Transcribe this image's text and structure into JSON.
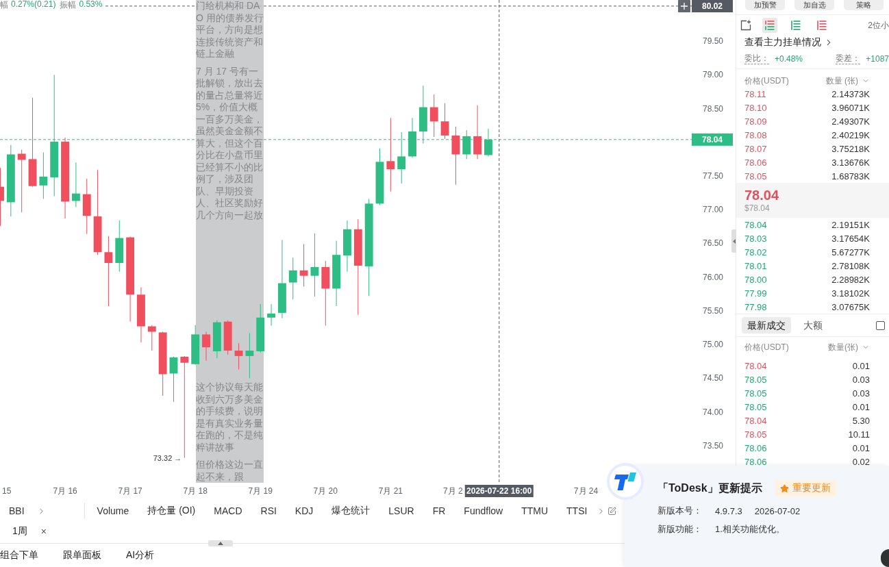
{
  "chart_info": [
    {
      "label": "幅",
      "value": "0.27%(0.21)"
    },
    {
      "label": "振幅",
      "value": "0.53%"
    }
  ],
  "chart": {
    "chart_data": [
      {
        "type": "candlestick",
        "x": [
          "2026-07-15T00:00",
          "2026-07-15T04:00",
          "2026-07-15T08:00",
          "2026-07-15T12:00",
          "2026-07-15T16:00",
          "2026-07-15T20:00",
          "2026-07-16T00:00",
          "2026-07-16T04:00",
          "2026-07-16T08:00",
          "2026-07-16T12:00",
          "2026-07-16T16:00",
          "2026-07-16T20:00",
          "2026-07-17T00:00",
          "2026-07-17T04:00",
          "2026-07-17T08:00",
          "2026-07-17T12:00",
          "2026-07-17T16:00",
          "2026-07-17T20:00",
          "2026-07-18T00:00",
          "2026-07-18T04:00",
          "2026-07-18T08:00",
          "2026-07-18T12:00",
          "2026-07-18T16:00",
          "2026-07-18T20:00",
          "2026-07-19T00:00",
          "2026-07-19T04:00",
          "2026-07-19T08:00",
          "2026-07-19T12:00",
          "2026-07-19T16:00",
          "2026-07-19T20:00",
          "2026-07-20T00:00",
          "2026-07-20T04:00",
          "2026-07-20T08:00",
          "2026-07-20T12:00",
          "2026-07-20T16:00",
          "2026-07-20T20:00",
          "2026-07-21T00:00",
          "2026-07-21T04:00",
          "2026-07-21T08:00",
          "2026-07-21T12:00",
          "2026-07-21T16:00",
          "2026-07-21T20:00",
          "2026-07-22T00:00",
          "2026-07-22T04:00",
          "2026-07-22T08:00",
          "2026-07-22T12:00"
        ],
        "ohlc": [
          [
            77.34,
            77.62,
            76.76,
            77.13
          ],
          [
            77.11,
            77.96,
            76.9,
            77.82
          ],
          [
            77.83,
            77.89,
            76.96,
            77.74
          ],
          [
            77.75,
            78.66,
            77.34,
            77.35
          ],
          [
            77.36,
            77.85,
            77.16,
            77.49
          ],
          [
            77.48,
            79.0,
            77.2,
            78.01
          ],
          [
            78.01,
            78.07,
            76.87,
            77.12
          ],
          [
            77.13,
            77.7,
            77.04,
            77.24
          ],
          [
            77.23,
            77.46,
            76.64,
            76.91
          ],
          [
            76.9,
            77.59,
            76.33,
            76.37
          ],
          [
            76.37,
            76.61,
            75.57,
            76.21
          ],
          [
            76.21,
            76.84,
            76.08,
            76.58
          ],
          [
            76.59,
            76.6,
            75.34,
            75.74
          ],
          [
            75.74,
            75.85,
            75.03,
            75.27
          ],
          [
            75.27,
            75.29,
            74.91,
            75.19
          ],
          [
            75.18,
            75.19,
            74.24,
            74.56
          ],
          [
            74.57,
            74.82,
            74.15,
            74.81
          ],
          [
            74.82,
            74.83,
            73.32,
            74.73
          ],
          [
            74.71,
            75.29,
            74.7,
            75.15
          ],
          [
            75.15,
            75.19,
            74.76,
            74.96
          ],
          [
            74.9,
            75.36,
            74.8,
            75.33
          ],
          [
            75.34,
            75.36,
            74.85,
            74.91
          ],
          [
            74.91,
            75.02,
            74.63,
            74.83
          ],
          [
            74.83,
            75.17,
            74.5,
            74.91
          ],
          [
            74.9,
            75.6,
            74.88,
            75.4
          ],
          [
            75.4,
            75.6,
            75.28,
            75.46
          ],
          [
            75.47,
            76.55,
            75.39,
            75.91
          ],
          [
            75.92,
            76.29,
            75.67,
            76.1
          ],
          [
            76.1,
            76.49,
            75.86,
            76.02
          ],
          [
            76.02,
            76.65,
            75.71,
            76.15
          ],
          [
            76.15,
            76.24,
            75.28,
            75.83
          ],
          [
            75.83,
            76.54,
            75.57,
            76.33
          ],
          [
            76.32,
            76.84,
            76.08,
            76.71
          ],
          [
            76.71,
            76.86,
            75.44,
            76.17
          ],
          [
            76.16,
            77.16,
            75.72,
            77.09
          ],
          [
            77.09,
            77.91,
            77.07,
            77.71
          ],
          [
            77.72,
            78.36,
            77.27,
            77.6
          ],
          [
            77.6,
            78.15,
            77.39,
            77.79
          ],
          [
            77.79,
            78.36,
            77.77,
            78.16
          ],
          [
            78.16,
            78.84,
            77.98,
            78.52
          ],
          [
            78.52,
            78.71,
            78.08,
            78.31
          ],
          [
            78.31,
            78.58,
            78.05,
            78.1
          ],
          [
            78.1,
            78.23,
            77.37,
            77.82
          ],
          [
            77.82,
            78.18,
            77.75,
            78.09
          ],
          [
            78.09,
            78.55,
            77.75,
            77.82
          ],
          [
            77.81,
            78.2,
            77.79,
            78.04
          ]
        ],
        "colors": [
          "#f0505e",
          "#2ebd85",
          "#f0505e",
          "#f0505e",
          "#2ebd85",
          "#2ebd85",
          "#f0505e",
          "#2ebd85",
          "#f0505e",
          "#f0505e",
          "#f0505e",
          "#2ebd85",
          "#f0505e",
          "#f0505e",
          "#f0505e",
          "#f0505e",
          "#2ebd85",
          "#f0505e",
          "#2ebd85",
          "#f0505e",
          "#2ebd85",
          "#f0505e",
          "#f0505e",
          "#2ebd85",
          "#2ebd85",
          "#2ebd85",
          "#2ebd85",
          "#2ebd85",
          "#f0505e",
          "#2ebd85",
          "#f0505e",
          "#2ebd85",
          "#2ebd85",
          "#f0505e",
          "#2ebd85",
          "#2ebd85",
          "#f0505e",
          "#2ebd85",
          "#2ebd85",
          "#2ebd85",
          "#f0505e",
          "#f0505e",
          "#f0505e",
          "#2ebd85",
          "#f0505e",
          "#2ebd85"
        ],
        "xlim": [
          "2026-07-15T00:00",
          "2026-07-25T15:00"
        ],
        "ylim": [
          72.95,
          80.11
        ],
        "xticks": [
          {
            "value": "2026-07-15T00:00",
            "label": "15"
          },
          {
            "value": "2026-07-16T00:00",
            "label": "7月 16"
          },
          {
            "value": "2026-07-17T00:00",
            "label": "7月 17"
          },
          {
            "value": "2026-07-18T00:00",
            "label": "7月 18"
          },
          {
            "value": "2026-07-19T00:00",
            "label": "7月 19"
          },
          {
            "value": "2026-07-20T00:00",
            "label": "7月 20"
          },
          {
            "value": "2026-07-21T00:00",
            "label": "7月 21"
          },
          {
            "value": "2026-07-22T00:00",
            "label": "7月 2"
          },
          {
            "value": "2026-07-24T00:00",
            "label": "7月 24"
          }
        ],
        "yticks": [
          {
            "value": 79.5,
            "label": "79.50"
          },
          {
            "value": 79.0,
            "label": "79.00"
          },
          {
            "value": 78.5,
            "label": "78.50"
          },
          {
            "value": 77.5,
            "label": "77.50"
          },
          {
            "value": 77.0,
            "label": "77.00"
          },
          {
            "value": 76.5,
            "label": "76.50"
          },
          {
            "value": 76.0,
            "label": "76.00"
          },
          {
            "value": 75.5,
            "label": "75.50"
          },
          {
            "value": 75.0,
            "label": "75.00"
          },
          {
            "value": 74.5,
            "label": "74.50"
          },
          {
            "value": 74.0,
            "label": "74.00"
          },
          {
            "value": 73.5,
            "label": "73.50"
          }
        ],
        "ref_lines": [
          {
            "axis": "y",
            "value": 78.04,
            "label": "78.04",
            "color": "#2ebd85",
            "line_style": "dashed"
          },
          {
            "axis": "y",
            "value": 80.02,
            "label": "80.02",
            "color": "#555a62",
            "line_style": "dashed"
          },
          {
            "axis": "x",
            "value": "2026-07-22T16:00",
            "label": "2026-07-22 16:00",
            "color": "#555a62",
            "line_style": "dashed"
          }
        ],
        "annotations": [
          "73.32 →"
        ]
      }
    ]
  },
  "note_overlay": {
    "paragraphs": [
      "门给机构和 DAO 用的债券发行平台，方向是想连接传统资产和链上金融",
      "7 月 17 号有一批解锁，放出去的量占总量将近 5%，价值大概一百多万美金，虽然美金金额不算大，但这个百分比在小盘币里已经算不小的比例了，涉及团队、早期投资人、社区奖励好几个方向一起放",
      "这个协议每天能收到六万多美金的手续费，说明是有真实业务量在跑的，不是纯粹讲故事",
      "但价格这边一直起不来，跟"
    ]
  },
  "indicator_bar": {
    "main": [
      "BBI"
    ],
    "sub": [
      "Volume",
      "持仓量 (OI)",
      "MACD",
      "RSI",
      "KDJ",
      "爆仓统计",
      "LSUR",
      "FR",
      "Fundflow",
      "TTMU",
      "TTSI"
    ]
  },
  "period_tags": [
    {
      "label": "1周",
      "close": "×"
    }
  ],
  "bottom_tabs": [
    "组合下单",
    "跟单面板",
    "AI分析"
  ],
  "order_panel": {
    "top_buttons": [
      "加预警",
      "加自选",
      "策略"
    ],
    "view_modes": [
      {
        "kind": "both",
        "selected": true
      },
      {
        "kind": "bids",
        "selected": false
      },
      {
        "kind": "asks",
        "selected": false
      }
    ],
    "decimals": "2位小",
    "link": "查看主力挂单情况",
    "ratio": {
      "label": "委比：",
      "value": "+0.48%"
    },
    "diff": {
      "label": "委差：",
      "value": "+1087"
    },
    "columns": [
      "价格(USDT)",
      "数量 (张)"
    ],
    "asks": [
      {
        "price": "78.11",
        "amount": "2.14373K"
      },
      {
        "price": "78.10",
        "amount": "3.96071K"
      },
      {
        "price": "78.09",
        "amount": "2.49307K"
      },
      {
        "price": "78.08",
        "amount": "2.40219K"
      },
      {
        "price": "78.07",
        "amount": "3.75218K"
      },
      {
        "price": "78.06",
        "amount": "3.13676K"
      },
      {
        "price": "78.05",
        "amount": "1.68783K"
      }
    ],
    "last_price": "78.04",
    "last_price_usd": "$78.04",
    "bids": [
      {
        "price": "78.04",
        "amount": "2.19151K"
      },
      {
        "price": "78.03",
        "amount": "3.17654K"
      },
      {
        "price": "78.02",
        "amount": "5.67277K"
      },
      {
        "price": "78.01",
        "amount": "2.78108K"
      },
      {
        "price": "78.00",
        "amount": "2.28982K"
      },
      {
        "price": "77.99",
        "amount": "3.18102K"
      },
      {
        "price": "77.98",
        "amount": "3.07675K"
      }
    ]
  },
  "trades": {
    "tabs": [
      {
        "label": "最新成交",
        "selected": true
      },
      {
        "label": "大额",
        "selected": false
      }
    ],
    "checkbox": {
      "checked": false
    },
    "columns": [
      "价格(USDT)",
      "数量(张)"
    ],
    "rows": [
      {
        "price": "78.04",
        "amount": "0.01",
        "kind": "sell"
      },
      {
        "price": "78.05",
        "amount": "0.03",
        "kind": "buy"
      },
      {
        "price": "78.05",
        "amount": "0.03",
        "kind": "buy"
      },
      {
        "price": "78.05",
        "amount": "0.01",
        "kind": "buy"
      },
      {
        "price": "78.04",
        "amount": "5.30",
        "kind": "sell"
      },
      {
        "price": "78.05",
        "amount": "10.11",
        "kind": "sell"
      },
      {
        "price": "78.06",
        "amount": "0.01",
        "kind": "buy"
      },
      {
        "price": "78.06",
        "amount": "0.02",
        "kind": "buy"
      }
    ]
  },
  "update_popup": {
    "title": "「ToDesk」更新提示",
    "badge": "重要更新",
    "rows": [
      {
        "label": "新版本号：",
        "values": [
          "4.9.7.3",
          "2026-07-02"
        ]
      },
      {
        "label": "新版功能：",
        "values": [
          "1.相关功能优化。"
        ]
      }
    ]
  }
}
